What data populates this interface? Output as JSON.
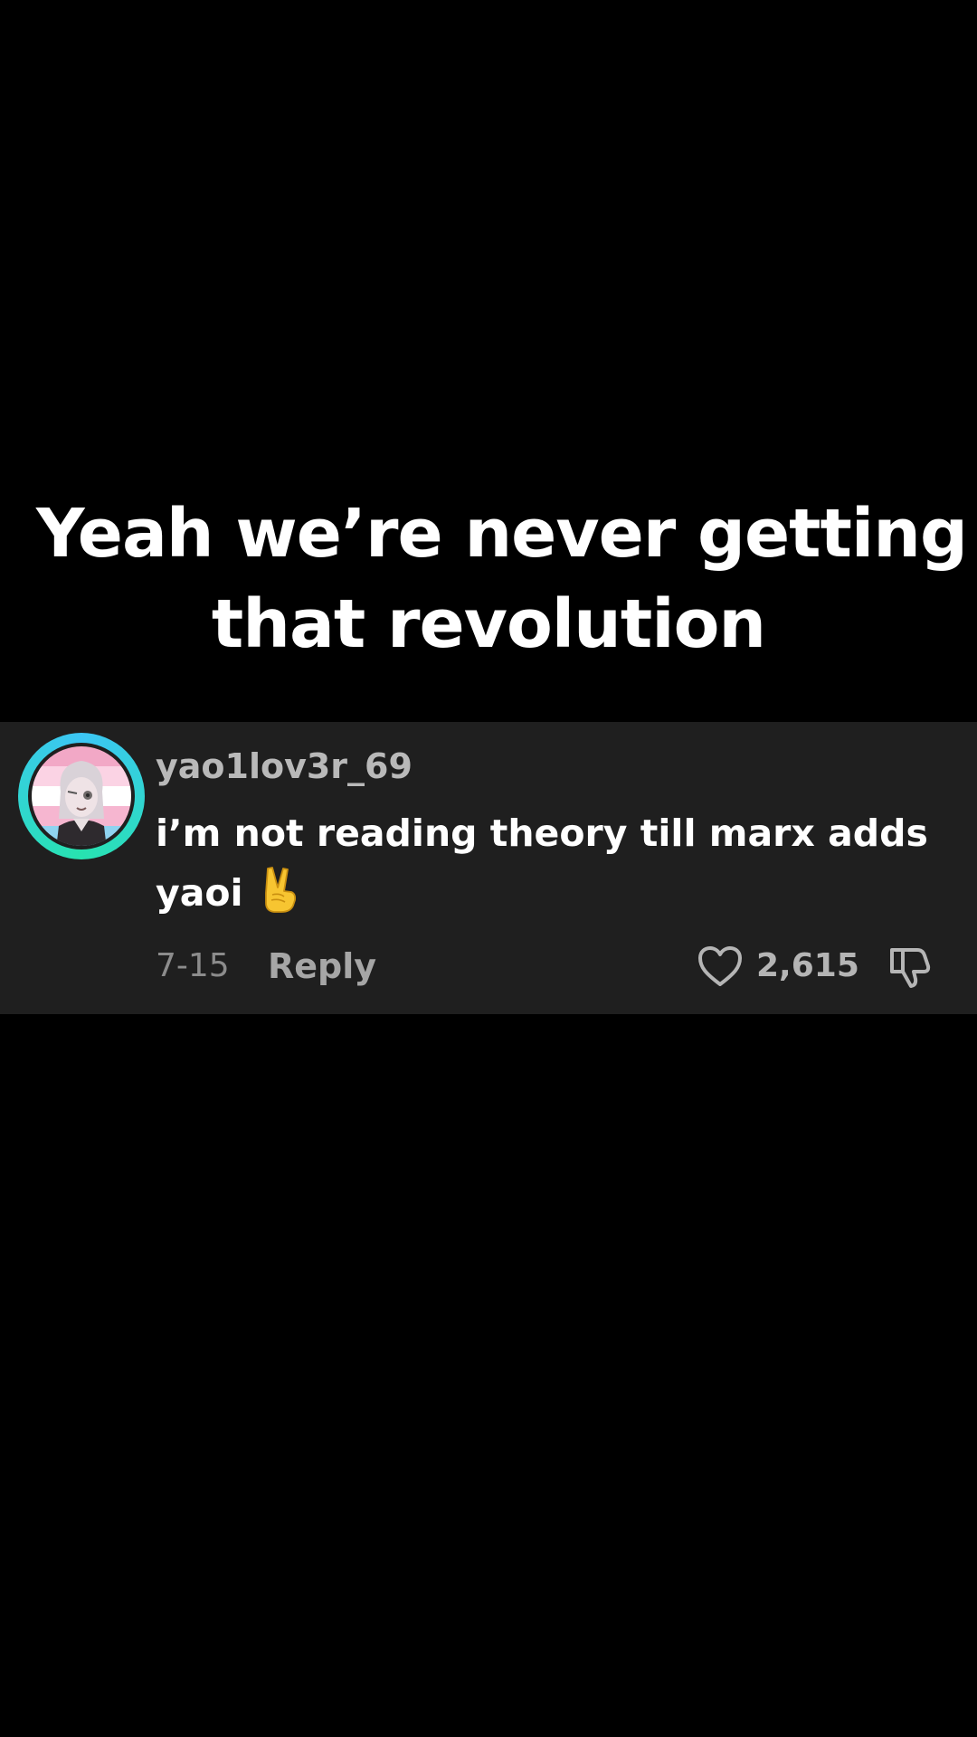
{
  "caption": {
    "line1": "Yeah we’re never getting",
    "line2": "that revolution"
  },
  "comment": {
    "username": "yao1lov3r_69",
    "text_line1": "i’m not reading theory till marx adds",
    "text_line2": "yaoi",
    "emoji": "victory-hand",
    "date": "7-15",
    "reply_label": "Reply",
    "like_count": "2,615"
  },
  "colors": {
    "background": "#000000",
    "card": "#1f1f1f",
    "avatar_ring_start": "#3cc6f5",
    "avatar_ring_end": "#27e3b0"
  },
  "icons": [
    "heart-icon",
    "dislike-icon",
    "victory-hand-emoji"
  ]
}
